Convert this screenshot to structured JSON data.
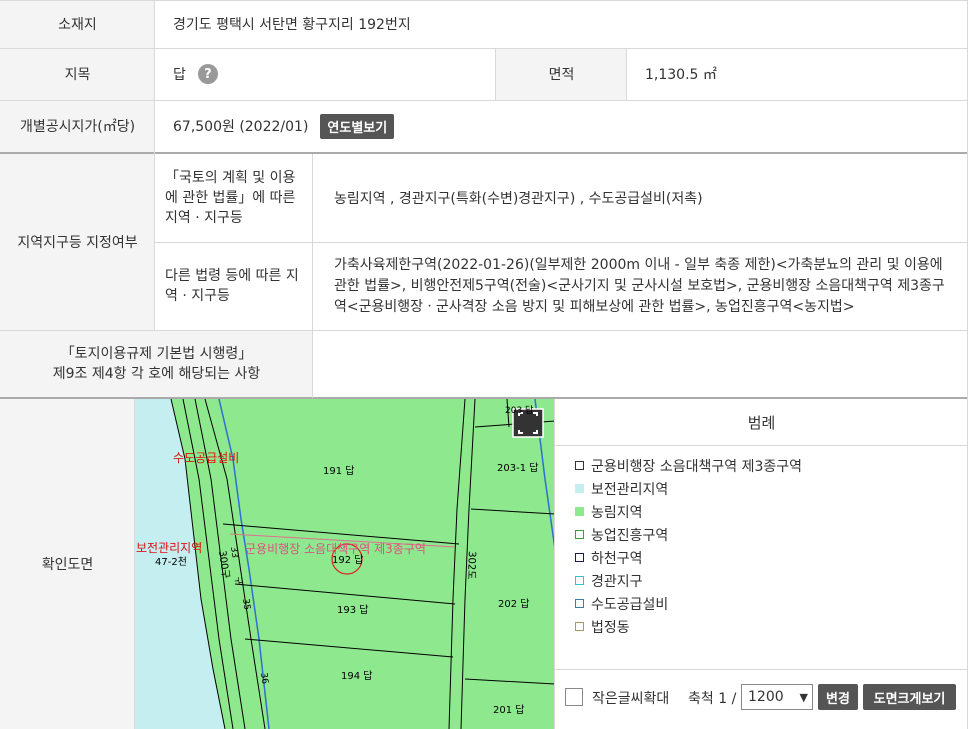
{
  "location": {
    "label": "소재지",
    "value": "경기도 평택시 서탄면 황구지리 192번지"
  },
  "land_category": {
    "label": "지목",
    "value": "답",
    "help_icon": "?"
  },
  "area": {
    "label": "면적",
    "value": "1,130.5 ㎡"
  },
  "official_price": {
    "label": "개별공시지가(㎡당)",
    "value": "67,500원 (2022/01)",
    "button": "연도별보기"
  },
  "zoning": {
    "label": "지역지구등 지정여부",
    "national_law_label": "「국토의 계획 및 이용에 관한 법률」에 따른 지역 · 지구등",
    "national_law_value": "농림지역 , 경관지구(특화(수변)경관지구) , 수도공급설비(저촉)",
    "other_law_label": "다른 법령 등에 따른 지역 · 지구등",
    "other_law_value": "가축사육제한구역(2022-01-26)(일부제한 2000m 이내 - 일부 축종 제한)<가축분뇨의 관리 및 이용에 관한 법률>, 비행안전제5구역(전술)<군사기지 및 군사시설 보호법>, 군용비행장 소음대책구역 제3종구역<군용비행장ㆍ군사격장 소음 방지 및 피해보상에 관한 법률>, 농업진흥구역<농지법>"
  },
  "decree": {
    "label_line1": "「토지이용규제 기본법 시행령」",
    "label_line2": "제9조 제4항 각 호에 해당되는 사항",
    "value": ""
  },
  "map": {
    "label": "확인도면",
    "labels": {
      "water": "수도공급설비",
      "conservation": "보전관리지역",
      "lot_472": "47-2천",
      "noise": "군용비행장 소음대책구역 제3종구역",
      "lot_191": "191 답",
      "lot_192": "192 답",
      "lot_193": "193 답",
      "lot_194": "194 답",
      "lot_2031": "203-1 답",
      "lot_202": "202 답",
      "lot_201": "201 답",
      "lot_203": "203 답",
      "road_300": "300구",
      "road_302": "302도",
      "lot_33": "33",
      "lot_35": "35",
      "lot_36": "36",
      "lot_25": "구"
    }
  },
  "legend": {
    "title": "범례",
    "items": [
      {
        "label": "군용비행장 소음대책구역 제3종구역",
        "fill": "#ffffff",
        "border": "#333333"
      },
      {
        "label": "보전관리지역",
        "fill": "#c5eef0",
        "border": "#c5eef0"
      },
      {
        "label": "농림지역",
        "fill": "#8ee88e",
        "border": "#8ee88e"
      },
      {
        "label": "농업진흥구역",
        "fill": "#ffffff",
        "border": "#3aa03a"
      },
      {
        "label": "하천구역",
        "fill": "#ffffff",
        "border": "#1a1a60"
      },
      {
        "label": "경관지구",
        "fill": "#ffffff",
        "border": "#2fc2d2"
      },
      {
        "label": "수도공급설비",
        "fill": "#ffffff",
        "border": "#3a7fa0"
      },
      {
        "label": "법정동",
        "fill": "#ffffff",
        "border": "#a89a60"
      }
    ]
  },
  "map_controls": {
    "enlarge_text_label": "작은글씨확대",
    "scale_label": "축척 1 /",
    "scale_value": "1200",
    "change_button": "변경",
    "enlarge_map_button": "도면크게보기"
  },
  "colors": {
    "farm": "#8ee88e",
    "conservation": "#c5eef0",
    "button": "#555555"
  }
}
